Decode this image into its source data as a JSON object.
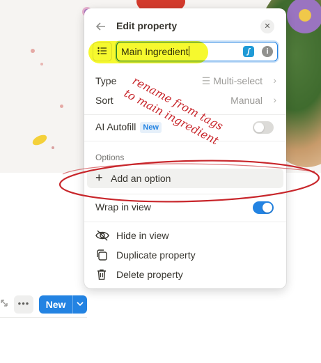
{
  "panel": {
    "title": "Edit property",
    "name_value": "Main Ingredient",
    "type_label": "Type",
    "type_value": "Multi-select",
    "sort_label": "Sort",
    "sort_value": "Manual",
    "ai_autofill_label": "AI Autofill",
    "ai_autofill_badge": "New",
    "ai_autofill_on": false,
    "options_section": "Options",
    "add_option_label": "Add an option",
    "wrap_label": "Wrap in view",
    "wrap_on": true,
    "actions": [
      {
        "label": "Hide in view",
        "icon": "eye-slash-icon"
      },
      {
        "label": "Duplicate property",
        "icon": "duplicate-icon"
      },
      {
        "label": "Delete property",
        "icon": "trash-icon"
      }
    ]
  },
  "toolbar": {
    "new_label": "New"
  },
  "annotation": {
    "line1": "rename from tags",
    "line2": "to main ingredient",
    "highlight_color": "#f4f800",
    "ink_color": "#c8262b"
  },
  "colors": {
    "accent": "#2383e2"
  }
}
